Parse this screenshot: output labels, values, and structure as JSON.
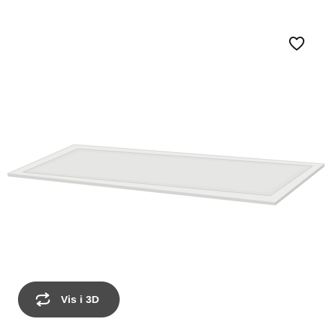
{
  "product": {
    "image_icon": "glass-shelf-product-image"
  },
  "favourite": {
    "icon": "heart-icon"
  },
  "view3d": {
    "label": "Vis i 3D",
    "icon": "rotate-3d-icon",
    "background": "#4a4a4a"
  }
}
